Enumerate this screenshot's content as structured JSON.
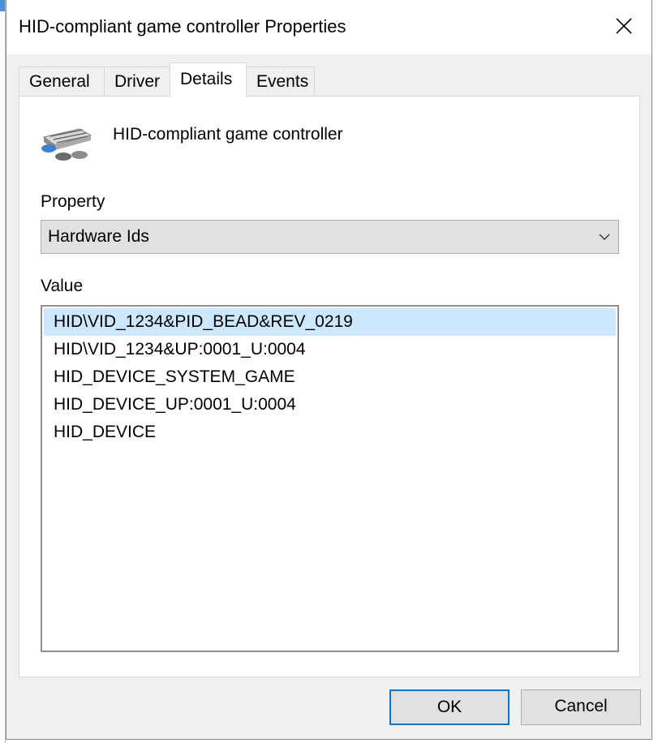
{
  "window": {
    "title": "HID-compliant game controller Properties"
  },
  "tabs": [
    {
      "label": "General"
    },
    {
      "label": "Driver"
    },
    {
      "label": "Details"
    },
    {
      "label": "Events"
    }
  ],
  "active_tab": "Details",
  "device": {
    "icon": "game-controller-icon",
    "name": "HID-compliant game controller"
  },
  "property": {
    "label": "Property",
    "selected": "Hardware Ids"
  },
  "value": {
    "label": "Value",
    "items": [
      "HID\\VID_1234&PID_BEAD&REV_0219",
      "HID\\VID_1234&UP:0001_U:0004",
      "HID_DEVICE_SYSTEM_GAME",
      "HID_DEVICE_UP:0001_U:0004",
      "HID_DEVICE"
    ],
    "selected_index": 0
  },
  "buttons": {
    "ok": "OK",
    "cancel": "Cancel"
  },
  "colors": {
    "selection": "#cce8ff",
    "default_button_border": "#0078d7",
    "background_window_accent": "#4a90d9"
  }
}
